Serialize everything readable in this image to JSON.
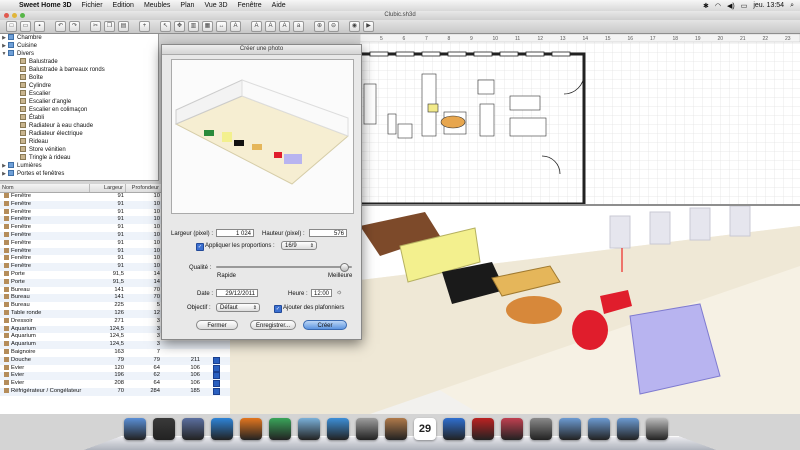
{
  "menubar": {
    "app_name": "Sweet Home 3D",
    "items": [
      "Fichier",
      "Edition",
      "Meubles",
      "Plan",
      "Vue 3D",
      "Fenêtre",
      "Aide"
    ],
    "clock": "jeu. 13:54"
  },
  "window": {
    "title": "Clubic.sh3d"
  },
  "plan": {
    "ruler_ticks": [
      "5",
      "6",
      "7",
      "8",
      "9",
      "10",
      "11",
      "12",
      "13",
      "14",
      "15",
      "16",
      "17",
      "18",
      "19",
      "20",
      "21",
      "22",
      "23"
    ]
  },
  "catalog": {
    "categories": [
      {
        "label": "Chambre",
        "expanded": false
      },
      {
        "label": "Cuisine",
        "expanded": false
      },
      {
        "label": "Divers",
        "expanded": true
      }
    ],
    "divers_items": [
      "Balustrade",
      "Balustrade à barreaux ronds",
      "Boîte",
      "Cylindre",
      "Escalier",
      "Escalier d'angle",
      "Escalier en colimaçon",
      "Établi",
      "Radiateur à eau chaude",
      "Radiateur électrique",
      "Rideau",
      "Store vénitien",
      "Tringle à rideau"
    ],
    "after_categories": [
      "Lumières",
      "Portes et fenêtres"
    ]
  },
  "furniture_table": {
    "headers": [
      "Nom",
      "Largeur",
      "Profondeur",
      "",
      ""
    ],
    "rows": [
      {
        "name": "Fenêtre",
        "w": "91",
        "d": "10"
      },
      {
        "name": "Fenêtre",
        "w": "91",
        "d": "10"
      },
      {
        "name": "Fenêtre",
        "w": "91",
        "d": "10"
      },
      {
        "name": "Fenêtre",
        "w": "91",
        "d": "10"
      },
      {
        "name": "Fenêtre",
        "w": "91",
        "d": "10"
      },
      {
        "name": "Fenêtre",
        "w": "91",
        "d": "10"
      },
      {
        "name": "Fenêtre",
        "w": "91",
        "d": "10"
      },
      {
        "name": "Fenêtre",
        "w": "91",
        "d": "10"
      },
      {
        "name": "Fenêtre",
        "w": "91",
        "d": "10"
      },
      {
        "name": "Fenêtre",
        "w": "91",
        "d": "10"
      },
      {
        "name": "Porte",
        "w": "91,5",
        "d": "14"
      },
      {
        "name": "Porte",
        "w": "91,5",
        "d": "14"
      },
      {
        "name": "Bureau",
        "w": "141",
        "d": "70"
      },
      {
        "name": "Bureau",
        "w": "141",
        "d": "70"
      },
      {
        "name": "Bureau",
        "w": "225",
        "d": "5"
      },
      {
        "name": "Table ronde",
        "w": "126",
        "d": "12"
      },
      {
        "name": "Dressoir",
        "w": "271",
        "d": "3"
      },
      {
        "name": "Aquarium",
        "w": "124,5",
        "d": "3"
      },
      {
        "name": "Aquarium",
        "w": "124,5",
        "d": "3"
      },
      {
        "name": "Aquarium",
        "w": "124,5",
        "d": "3"
      },
      {
        "name": "Baignoire",
        "w": "163",
        "d": "7"
      },
      {
        "name": "Douche",
        "w": "79",
        "d": "79",
        "h": "211"
      },
      {
        "name": "Evier",
        "w": "120",
        "d": "64",
        "h": "106"
      },
      {
        "name": "Evier",
        "w": "196",
        "d": "62",
        "h": "106"
      },
      {
        "name": "Evier",
        "w": "208",
        "d": "64",
        "h": "106"
      },
      {
        "name": "Réfrigérateur / Congélateur",
        "w": "70",
        "d": "284",
        "h": "185"
      }
    ]
  },
  "dialog": {
    "title": "Créer une photo",
    "width_label": "Largeur (pixel) :",
    "width_value": "1 024",
    "height_label": "Hauteur (pixel) :",
    "height_value": "576",
    "apply_ratio_label": "Appliquer les proportions :",
    "ratio_value": "16/9",
    "quality_label": "Qualité :",
    "quality_low": "Rapide",
    "quality_high": "Meilleure",
    "quality_fraction": 0.95,
    "date_label": "Date :",
    "date_value": "29/12/2011",
    "time_label": "Heure :",
    "time_value": "12:00",
    "lens_label": "Objectif :",
    "lens_value": "Défaut",
    "ceiling_lights_label": "Ajouter des plafonniers",
    "btn_close": "Fermer",
    "btn_save": "Enregistrer...",
    "btn_create": "Créer"
  },
  "dock": {
    "icons": [
      "finder",
      "dashboard",
      "mission-control",
      "app-store",
      "firefox",
      "chrome",
      "preview",
      "safari",
      "trash-app",
      "contacts",
      "ical",
      "itunes",
      "photo-booth",
      "sweet-home",
      "system-preferences",
      "applications",
      "documents",
      "downloads",
      "trash"
    ],
    "calendar_day": "29"
  }
}
